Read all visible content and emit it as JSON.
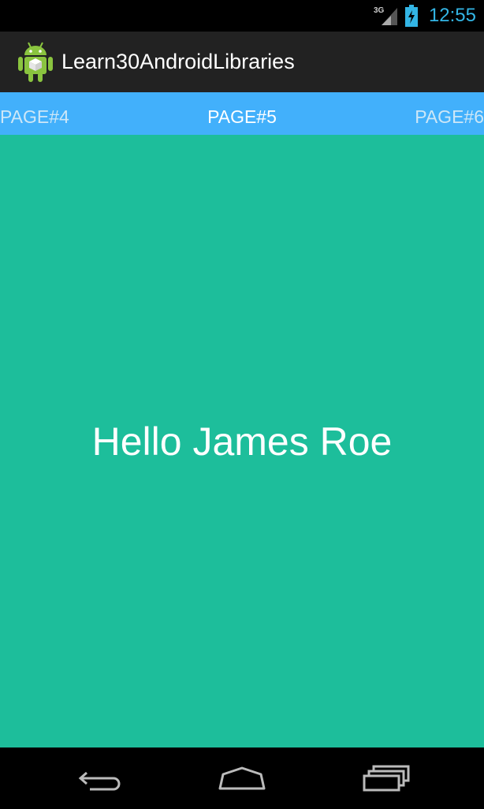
{
  "status_bar": {
    "network_type": "3G",
    "time": "12:55",
    "icons": [
      "signal-icon",
      "battery-charging-icon"
    ]
  },
  "action_bar": {
    "app_icon": "android-robot-icon",
    "title": "Learn30AndroidLibraries"
  },
  "pager": {
    "tabs": [
      {
        "label": "PAGE#4",
        "state": "previous"
      },
      {
        "label": "PAGE#5",
        "state": "current"
      },
      {
        "label": "PAGE#6",
        "state": "next"
      }
    ]
  },
  "content": {
    "text": "Hello James Roe"
  },
  "nav_bar": {
    "buttons": [
      "back-icon",
      "home-icon",
      "recents-icon"
    ]
  },
  "colors": {
    "status_time": "#33b5e5",
    "action_bar_bg": "#222222",
    "tab_strip_bg": "#42b0fb",
    "content_bg": "#1dbe9b"
  }
}
